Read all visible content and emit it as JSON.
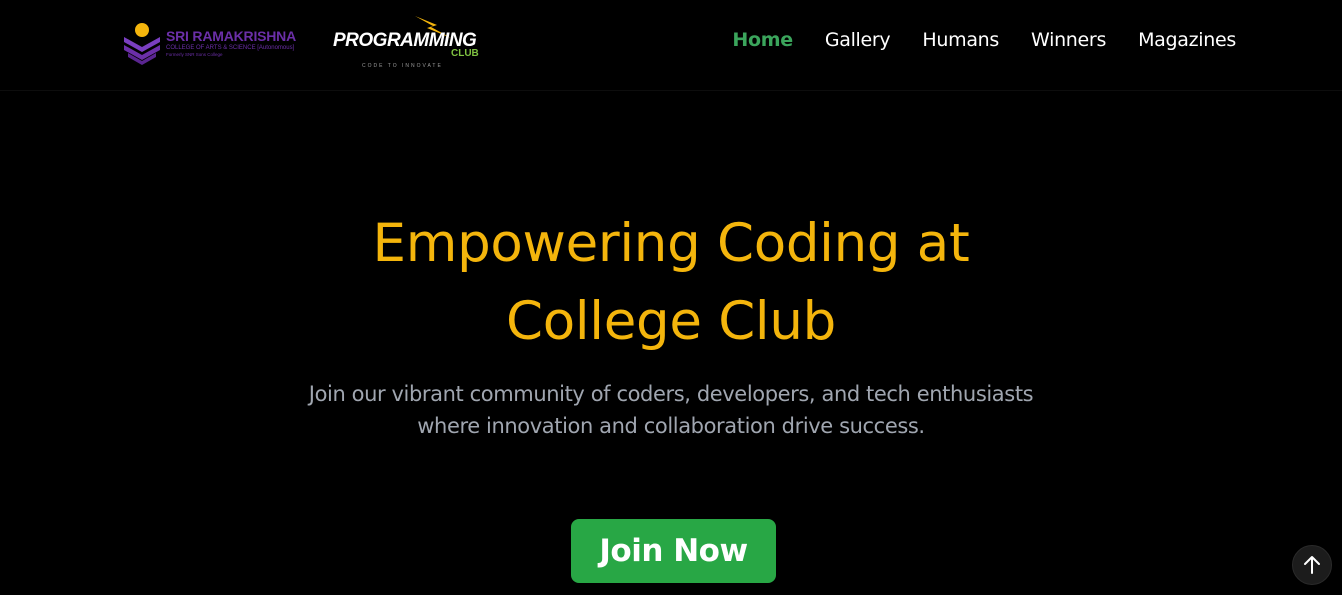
{
  "header": {
    "college_logo": {
      "name": "SRI RAMAKRISHNA",
      "subtitle": "COLLEGE OF ARTS & SCIENCE [Autonomous]",
      "former": "Formerly SNR Sons College"
    },
    "club_logo": {
      "main": "PROGRAMMING",
      "sub": "CLUB",
      "tagline": "CODE TO INNOVATE"
    },
    "nav": [
      {
        "label": "Home",
        "active": true
      },
      {
        "label": "Gallery",
        "active": false
      },
      {
        "label": "Humans",
        "active": false
      },
      {
        "label": "Winners",
        "active": false
      },
      {
        "label": "Magazines",
        "active": false
      }
    ]
  },
  "hero": {
    "title_line1": "Empowering Coding at",
    "title_line2": "College Club",
    "subtitle_line1": "Join our vibrant community of coders, developers, and tech enthusiasts",
    "subtitle_line2": "where innovation and collaboration drive success.",
    "cta_label": "Join Now"
  },
  "scroll_top": {
    "icon": "arrow-up-icon"
  },
  "colors": {
    "background": "#000000",
    "accent_yellow": "#f4b50c",
    "accent_green": "#28a745",
    "nav_active": "#3ba55c",
    "college_purple": "#6b2fa8"
  }
}
